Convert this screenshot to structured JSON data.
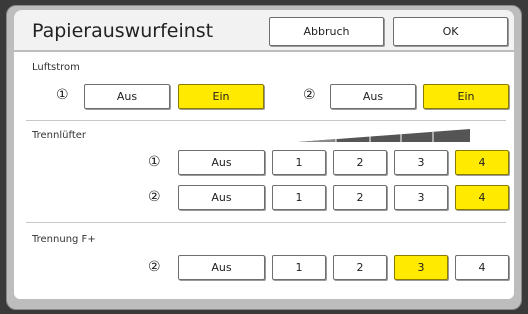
{
  "header": {
    "title": "Papierauswurfeinst",
    "cancel_label": "Abbruch",
    "ok_label": "OK"
  },
  "luftstrom": {
    "label": "Luftstrom",
    "rows": [
      {
        "marker": "①",
        "options": [
          "Aus",
          "Ein"
        ],
        "selected": "Ein"
      },
      {
        "marker": "②",
        "options": [
          "Aus",
          "Ein"
        ],
        "selected": "Ein"
      }
    ]
  },
  "trennluefter": {
    "label": "Trennlüfter",
    "rows": [
      {
        "marker": "①",
        "options": [
          "Aus",
          "1",
          "2",
          "3",
          "4"
        ],
        "selected": "4"
      },
      {
        "marker": "②",
        "options": [
          "Aus",
          "1",
          "2",
          "3",
          "4"
        ],
        "selected": "4"
      }
    ]
  },
  "trennung": {
    "label": "Trennung F+",
    "rows": [
      {
        "marker": "②",
        "options": [
          "Aus",
          "1",
          "2",
          "3",
          "4"
        ],
        "selected": "3"
      }
    ]
  },
  "colors": {
    "selected": "#ffea00",
    "frame": "#bdbdbd",
    "background": "#3a3a3a"
  },
  "icons": {
    "level_wedge": "increasing-level-wedge-icon"
  }
}
